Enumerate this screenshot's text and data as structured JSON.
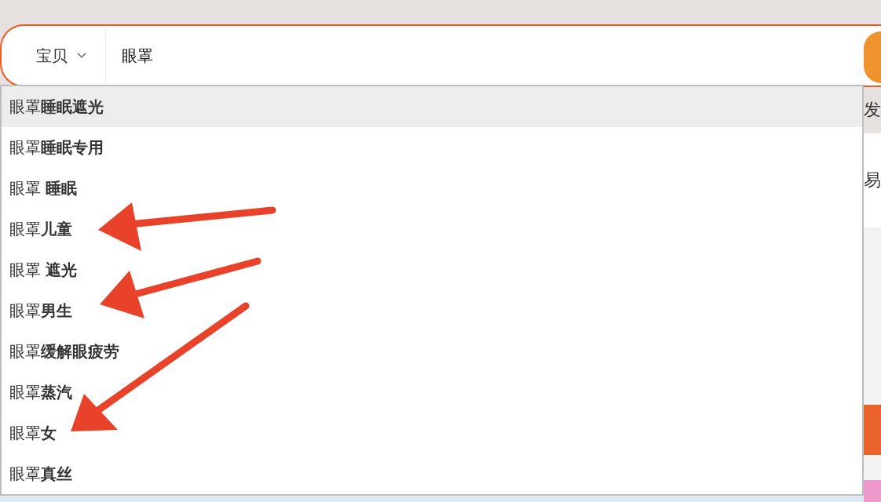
{
  "search": {
    "category": "宝贝",
    "query": "眼罩"
  },
  "suggestions": [
    {
      "text": "眼罩**睡眠遮光**",
      "selected": true
    },
    {
      "text": "眼罩**睡眠专用**",
      "selected": false
    },
    {
      "text": "眼罩 **睡眠**",
      "selected": false
    },
    {
      "text": "眼罩**儿童**",
      "selected": false
    },
    {
      "text": "眼罩 **遮光**",
      "selected": false
    },
    {
      "text": "眼罩**男生**",
      "selected": false
    },
    {
      "text": "眼罩**缓解眼疲劳**",
      "selected": false
    },
    {
      "text": "眼罩**蒸汽**",
      "selected": false
    },
    {
      "text": "眼罩**女**",
      "selected": false
    },
    {
      "text": "眼罩**真丝**",
      "selected": false
    }
  ],
  "background_texts": [
    "发",
    "易"
  ]
}
